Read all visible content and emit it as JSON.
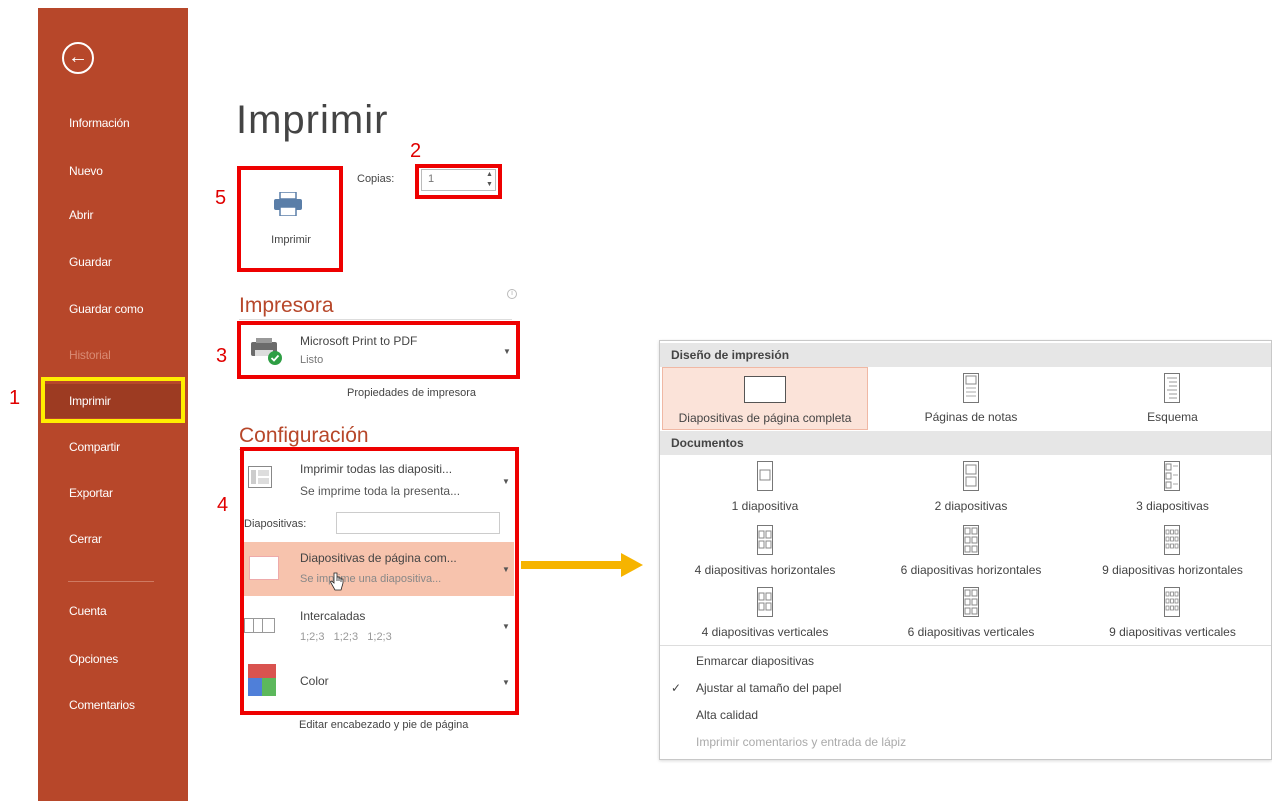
{
  "sidebar": {
    "back_icon": "back-arrow-icon",
    "items": [
      {
        "label": "Información"
      },
      {
        "label": "Nuevo"
      },
      {
        "label": "Abrir"
      },
      {
        "label": "Guardar"
      },
      {
        "label": "Guardar como"
      },
      {
        "label": "Historial"
      },
      {
        "label": "Imprimir"
      },
      {
        "label": "Compartir"
      },
      {
        "label": "Exportar"
      },
      {
        "label": "Cerrar"
      },
      {
        "label": "Cuenta"
      },
      {
        "label": "Opciones"
      },
      {
        "label": "Comentarios"
      }
    ]
  },
  "main": {
    "title": "Imprimir",
    "print_button_label": "Imprimir",
    "copies_label": "Copias:",
    "copies_value": "1",
    "printer_section": "Impresora",
    "printer_name": "Microsoft Print to PDF",
    "printer_status": "Listo",
    "printer_properties": "Propiedades de impresora",
    "config_section": "Configuración",
    "settings": {
      "range_title": "Imprimir todas las diapositi...",
      "range_sub": "Se imprime toda la presenta...",
      "slides_label": "Diapositivas:",
      "layout_title": "Diapositivas de página com...",
      "layout_sub": "Se imprime una diapositiva...",
      "collate_title": "Intercaladas",
      "collate_sub": "1;2;3   1;2;3   1;2;3",
      "color_title": "Color"
    },
    "footer_link": "Editar encabezado y pie de página"
  },
  "annotations": [
    "1",
    "2",
    "3",
    "4",
    "5"
  ],
  "popup": {
    "layout_header": "Diseño de impresión",
    "layouts": [
      {
        "label": "Diapositivas de página completa",
        "selected": true
      },
      {
        "label": "Páginas de notas"
      },
      {
        "label": "Esquema"
      }
    ],
    "handouts_header": "Documentos",
    "handouts": [
      {
        "label": "1 diapositiva"
      },
      {
        "label": "2 diapositivas"
      },
      {
        "label": "3 diapositivas"
      },
      {
        "label": "4 diapositivas horizontales"
      },
      {
        "label": "6 diapositivas horizontales"
      },
      {
        "label": "9 diapositivas horizontales"
      },
      {
        "label": "4 diapositivas verticales"
      },
      {
        "label": "6 diapositivas verticales"
      },
      {
        "label": "9 diapositivas verticales"
      }
    ],
    "options": [
      {
        "label": "Enmarcar diapositivas",
        "checked": false
      },
      {
        "label": "Ajustar al tamaño del papel",
        "checked": true
      },
      {
        "label": "Alta calidad",
        "checked": false
      },
      {
        "label": "Imprimir comentarios y entrada de lápiz",
        "disabled": true
      }
    ]
  },
  "colors": {
    "accent": "#b7472a",
    "annotation_red": "#ee0000",
    "annotation_yellow": "#ffee00",
    "arrow": "#f6b400",
    "selected_bg": "#fbe3d9"
  }
}
